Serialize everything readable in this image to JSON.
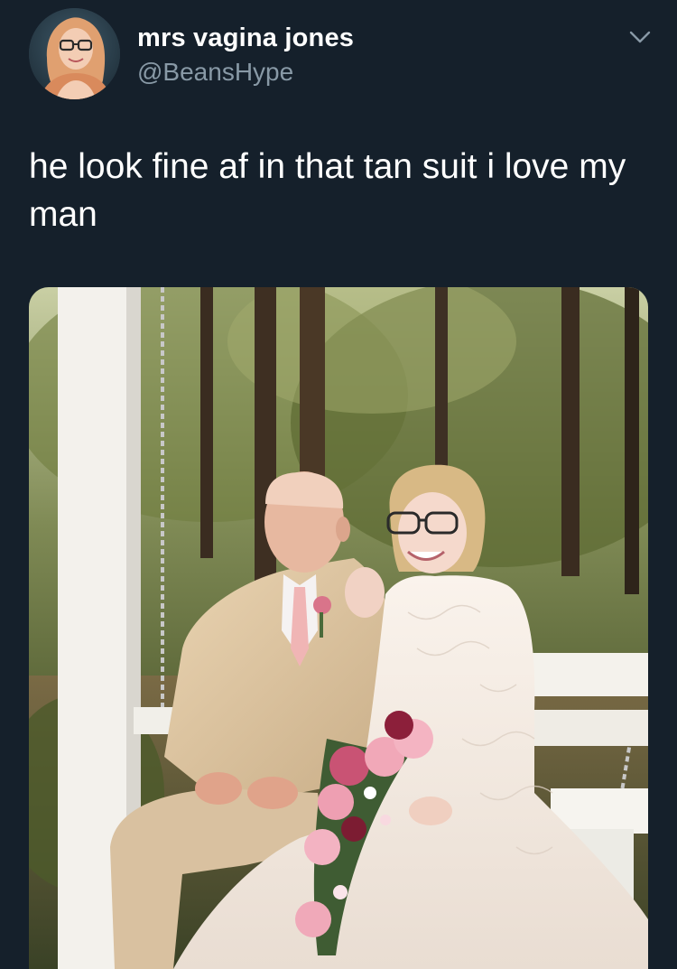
{
  "tweet": {
    "author": {
      "display_name": "mrs vagina jones",
      "handle": "@BeansHype",
      "avatar_icon": "profile-photo"
    },
    "menu_icon": "chevron-down-icon",
    "text": "he look fine af in that tan suit i love my man",
    "media": {
      "type": "photo",
      "subject": "elderly man in tan suit seated on white porch swing beside young bride in lace wedding gown holding pink rose bouquet, trees in background"
    }
  },
  "colors": {
    "background": "#15202b",
    "primary_text": "#ffffff",
    "secondary_text": "#8899a6"
  }
}
